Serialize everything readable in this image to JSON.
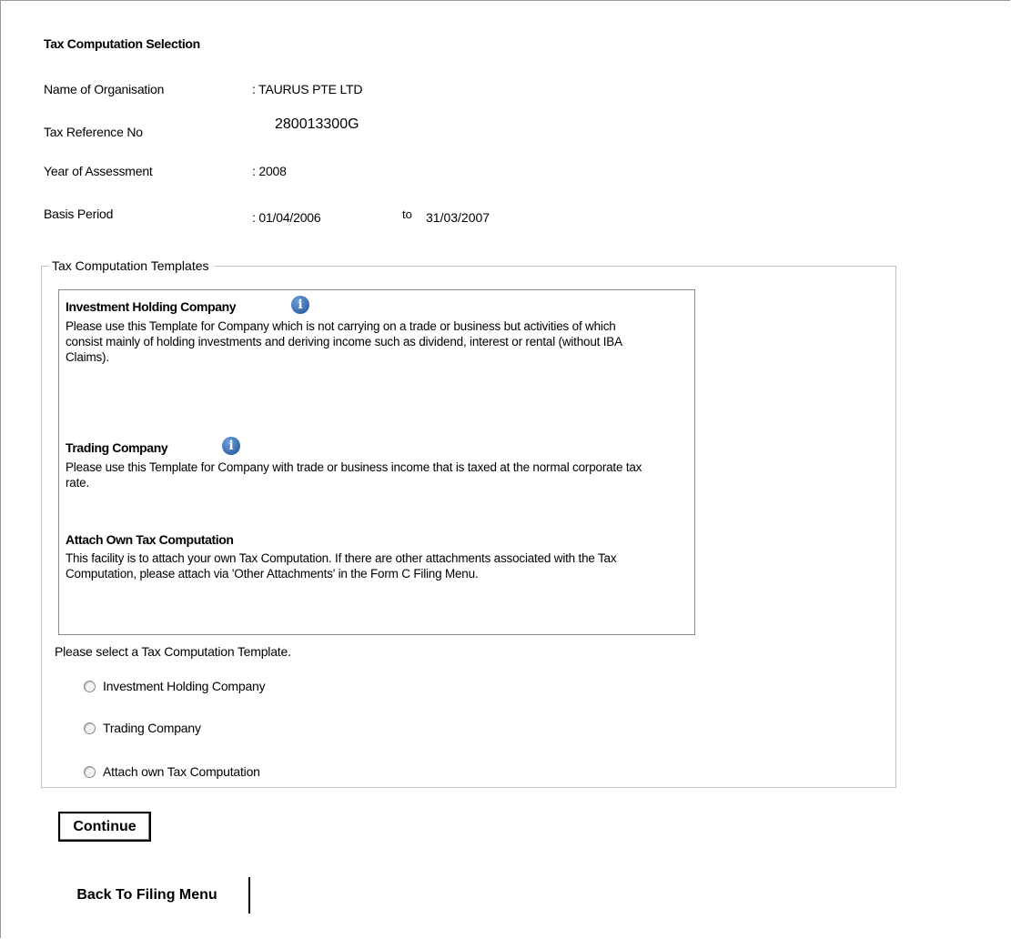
{
  "page": {
    "title": "Tax Computation Selection"
  },
  "organisation": {
    "name_label": "Name of Organisation",
    "name_value": ": TAURUS PTE LTD",
    "ref_label": "Tax Reference No",
    "ref_value": "280013300G",
    "ya_label": "Year of Assessment",
    "ya_value": ":  2008",
    "basis_label": "Basis Period",
    "basis_from": ":  01/04/2006",
    "basis_to_word": "to",
    "basis_to": "31/03/2007"
  },
  "templates": {
    "legend": "Tax Computation Templates",
    "items": [
      {
        "title": "Investment Holding Company",
        "description": "Please use this Template for Company which is not carrying on a trade or business but activities of which consist mainly of holding investments and deriving income such as dividend, interest or rental (without IBA Claims).",
        "icon": "info-icon"
      },
      {
        "title": "Trading Company",
        "description": "Please use this Template for Company with trade or business income that is taxed at the normal corporate tax rate.",
        "icon": "info-icon"
      },
      {
        "title": "Attach Own Tax Computation",
        "description": "This facility is to attach your own Tax Computation. If there are other attachments associated with the Tax Computation, please attach via 'Other Attachments' in the Form C Filing Menu."
      }
    ],
    "select_prompt": "Please select a Tax Computation Template.",
    "options": [
      {
        "label": "Investment Holding Company",
        "selected": false
      },
      {
        "label": "Trading Company",
        "selected": false
      },
      {
        "label": "Attach own Tax Computation",
        "selected": false
      }
    ],
    "continue_label": "Continue"
  },
  "footer": {
    "back_label": "Back To Filing Menu"
  },
  "colors": {
    "info_icon": "#1f4f9a",
    "border": "#c0c0c0"
  }
}
